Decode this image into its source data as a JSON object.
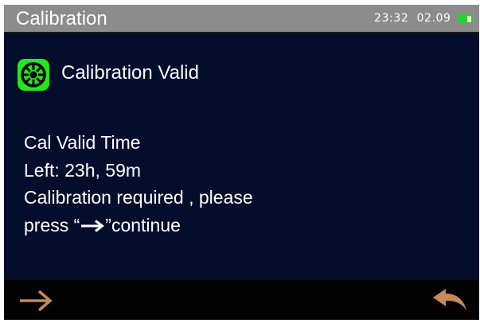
{
  "status_bar": {
    "title": "Calibration",
    "time": "23:32",
    "date": "02.09",
    "battery_icon": "battery-charging-icon",
    "battery_color": "#29d22a"
  },
  "calibration": {
    "status_icon": "calibration-gear-icon",
    "status_icon_color": "#22e81e",
    "status_text": "Calibration Valid"
  },
  "message": {
    "line1": "Cal Valid Time",
    "line2": "Left: 23h, 59m",
    "line3": "Calibration required , please",
    "line4_prefix": "press “",
    "line4_arrow_icon": "right-arrow-icon",
    "line4_suffix": "”continue"
  },
  "bottom_bar": {
    "next_icon": "right-arrow-icon",
    "back_icon": "return-arrow-icon",
    "icon_color": "#c58a5b"
  }
}
